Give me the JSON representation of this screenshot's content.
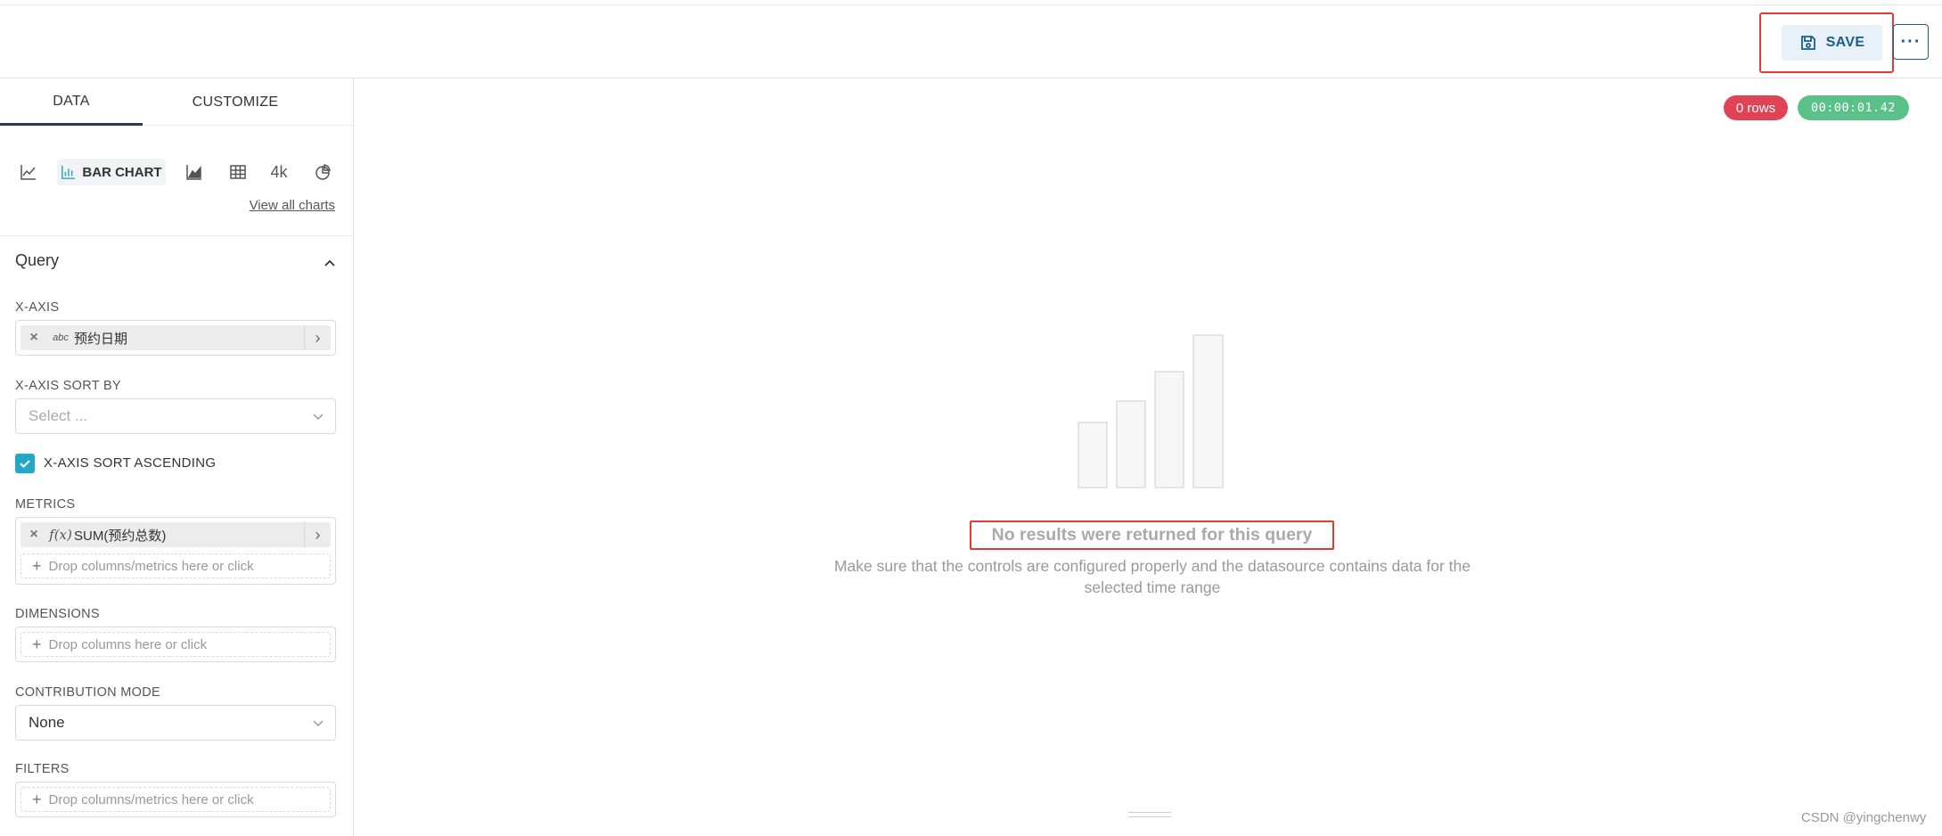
{
  "header": {
    "save_label": "SAVE",
    "more_label": "···"
  },
  "sidebar": {
    "tabs": [
      {
        "label": "DATA",
        "active": true
      },
      {
        "label": "CUSTOMIZE",
        "active": false
      }
    ],
    "charts": {
      "active_label": "BAR CHART",
      "big_number_label": "4k",
      "view_all": "View all charts"
    },
    "query": {
      "title": "Query",
      "x_axis": {
        "label": "X-AXIS",
        "value": "预约日期",
        "type_icon": "abc"
      },
      "x_axis_sort_by": {
        "label": "X-AXIS SORT BY",
        "placeholder": "Select ..."
      },
      "x_axis_sort_ascending": {
        "label": "X-AXIS SORT ASCENDING",
        "checked": true
      },
      "metrics": {
        "label": "METRICS",
        "value": "SUM(预约总数)",
        "type_icon": "f(x)",
        "drop_hint": "Drop columns/metrics here or click"
      },
      "dimensions": {
        "label": "DIMENSIONS",
        "drop_hint": "Drop columns here or click"
      },
      "contribution_mode": {
        "label": "CONTRIBUTION MODE",
        "value": "None"
      },
      "filters": {
        "label": "FILTERS",
        "drop_hint": "Drop columns/metrics here or click"
      }
    }
  },
  "main": {
    "rows_badge": "0 rows",
    "time_badge": "00:00:01.42",
    "empty_title": "No results were returned for this query",
    "empty_desc": "Make sure that the controls are configured properly and the datasource contains data for the selected time range",
    "watermark": "CSDN @yingchenwy"
  },
  "colors": {
    "accent": "#20a7c9",
    "primary": "#1a5d8f",
    "danger_badge": "#e04355",
    "success_badge": "#5ac189",
    "highlight": "#e53935"
  }
}
